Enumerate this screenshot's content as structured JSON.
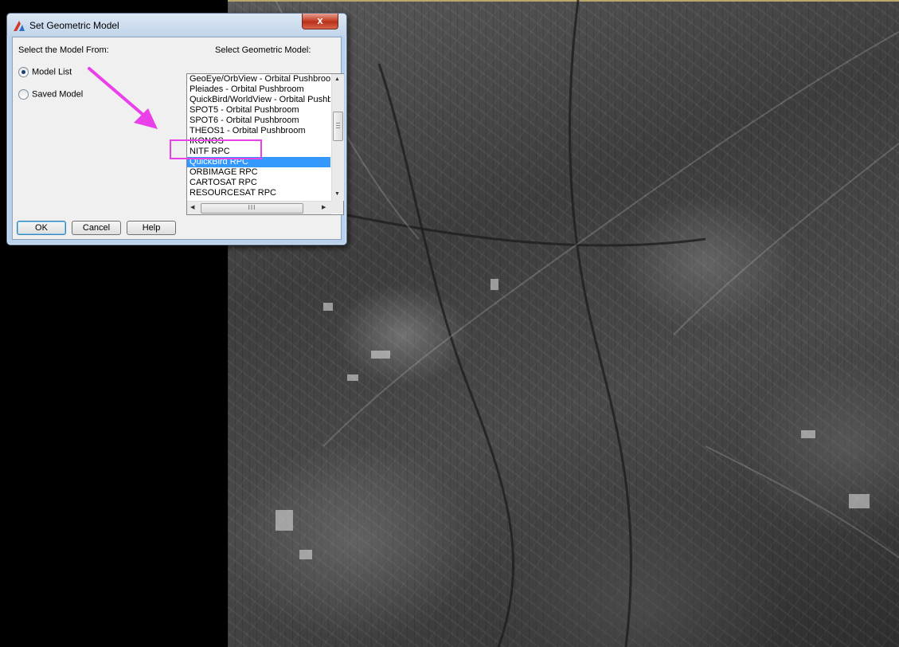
{
  "dialog": {
    "title": "Set Geometric Model",
    "close_label": "x",
    "select_from_label": "Select the Model From:",
    "select_model_label": "Select Geometric Model:",
    "source_options": [
      {
        "label": "Model List",
        "selected": true
      },
      {
        "label": "Saved Model",
        "selected": false
      }
    ],
    "models": [
      "GeoEye/OrbView - Orbital Pushbroom",
      "Pleiades - Orbital Pushbroom",
      "QuickBird/WorldView - Orbital Pushbroom",
      "SPOT5 - Orbital Pushbroom",
      "SPOT6 - Orbital Pushbroom",
      "THEOS1 - Orbital Pushbroom",
      "IKONOS",
      "NITF RPC",
      "QuickBird RPC",
      "ORBIMAGE RPC",
      "CARTOSAT RPC",
      "RESOURCESAT RPC"
    ],
    "selected_model": "QuickBird RPC",
    "scroll_grip": "III",
    "buttons": {
      "ok": "OK",
      "cancel": "Cancel",
      "help": "Help"
    }
  },
  "annotation": {
    "color": "#e940e9"
  },
  "icons": {
    "app": "app-logo-icon",
    "scroll_up": "scroll-up-arrow-icon",
    "scroll_down": "scroll-down-arrow-icon",
    "scroll_left": "scroll-left-arrow-icon",
    "scroll_right": "scroll-right-arrow-icon"
  }
}
